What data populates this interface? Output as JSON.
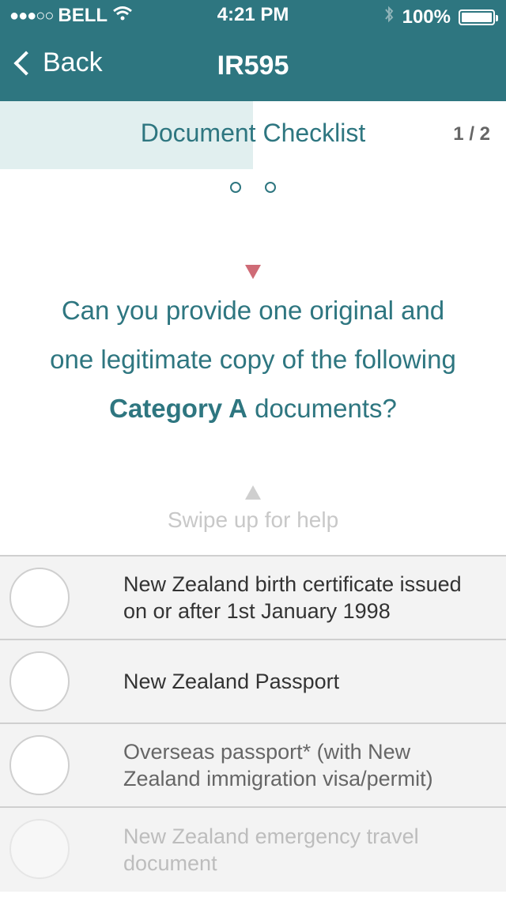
{
  "status_bar": {
    "signal_dots": "●●●○○",
    "carrier": "BELL",
    "time": "4:21 PM",
    "battery_percent": "100%",
    "icons": [
      "wifi-icon",
      "bluetooth-icon",
      "battery-icon"
    ]
  },
  "nav": {
    "back_label": "Back",
    "title": "IR595"
  },
  "checklist": {
    "section_title": "Document Checklist",
    "page_indicator": "1 / 2",
    "progress_fraction": 0.5
  },
  "question": {
    "line1": "Can you provide one original and",
    "line2": "one legitimate copy of the following",
    "emphasis": "Category A",
    "line3_rest": " documents?"
  },
  "help": {
    "text": "Swipe up for help"
  },
  "items": [
    {
      "label": "New Zealand birth certificate issued on or after 1st January 1998"
    },
    {
      "label": "New Zealand Passport"
    },
    {
      "label": "Overseas passport* (with New Zealand immigration visa/permit)"
    },
    {
      "label": "New Zealand emergency travel document"
    }
  ],
  "colors": {
    "header": "#2e7680",
    "accent_text": "#2e7680",
    "progress_fill": "#e1efef",
    "pointer": "#cf6b76"
  }
}
